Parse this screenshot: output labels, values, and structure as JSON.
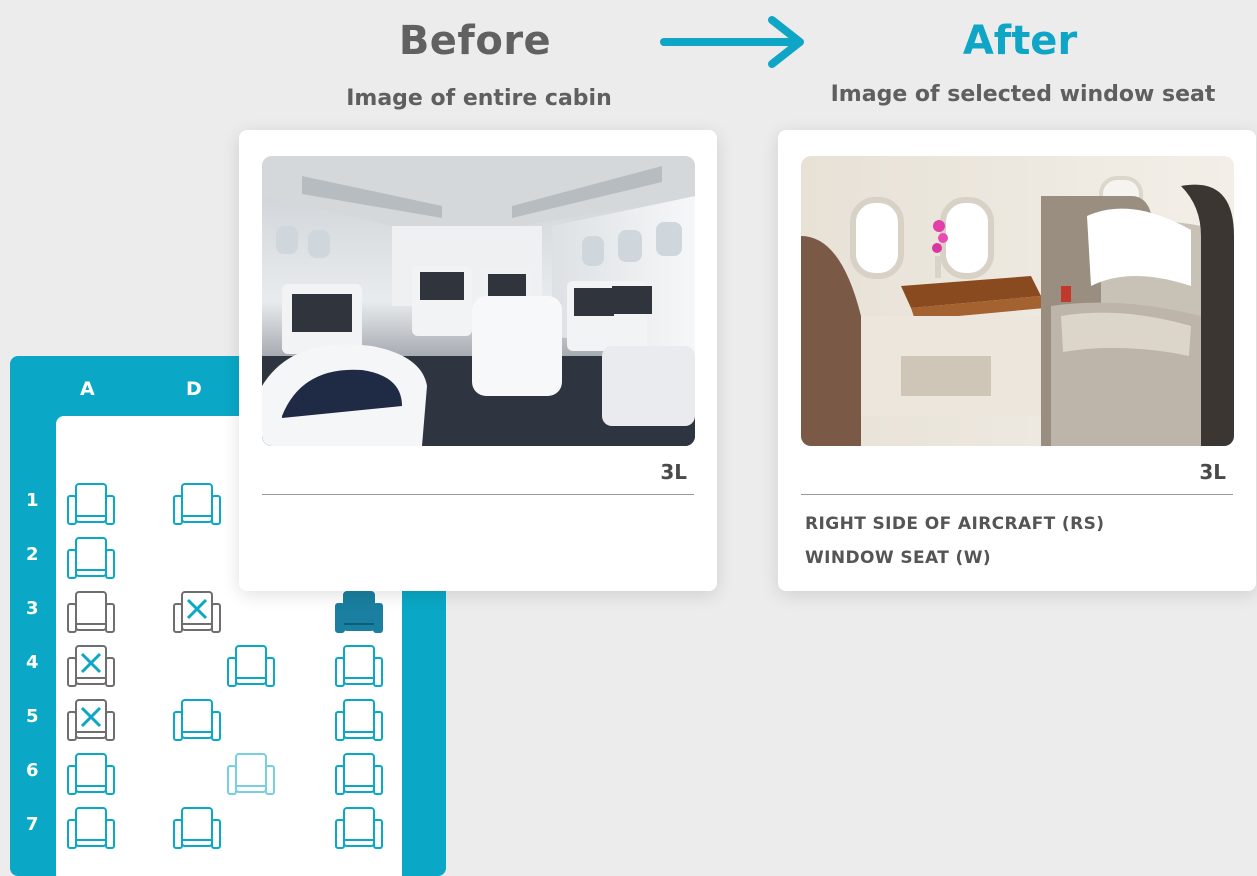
{
  "header": {
    "before_title": "Before",
    "before_subtitle": "Image of entire cabin",
    "after_title": "After",
    "after_subtitle": "Image of selected window seat",
    "arrow_icon": "arrow-right-icon",
    "accent_color": "#0ea5c6"
  },
  "seat_map": {
    "columns": [
      "A",
      "D"
    ],
    "rows": [
      "1",
      "2",
      "3",
      "4",
      "5",
      "6",
      "7"
    ],
    "legend_colors": {
      "available": "#0aa8c6",
      "occupied": "#6e6e6e",
      "selected": "#1a7fa0"
    }
  },
  "before_card": {
    "image": "cabin-overview-image",
    "seat_code": "3L"
  },
  "after_card": {
    "image": "window-seat-image",
    "seat_code": "3L",
    "line1": "RIGHT SIDE OF AIRCRAFT (RS)",
    "line2": "WINDOW SEAT (W)"
  }
}
